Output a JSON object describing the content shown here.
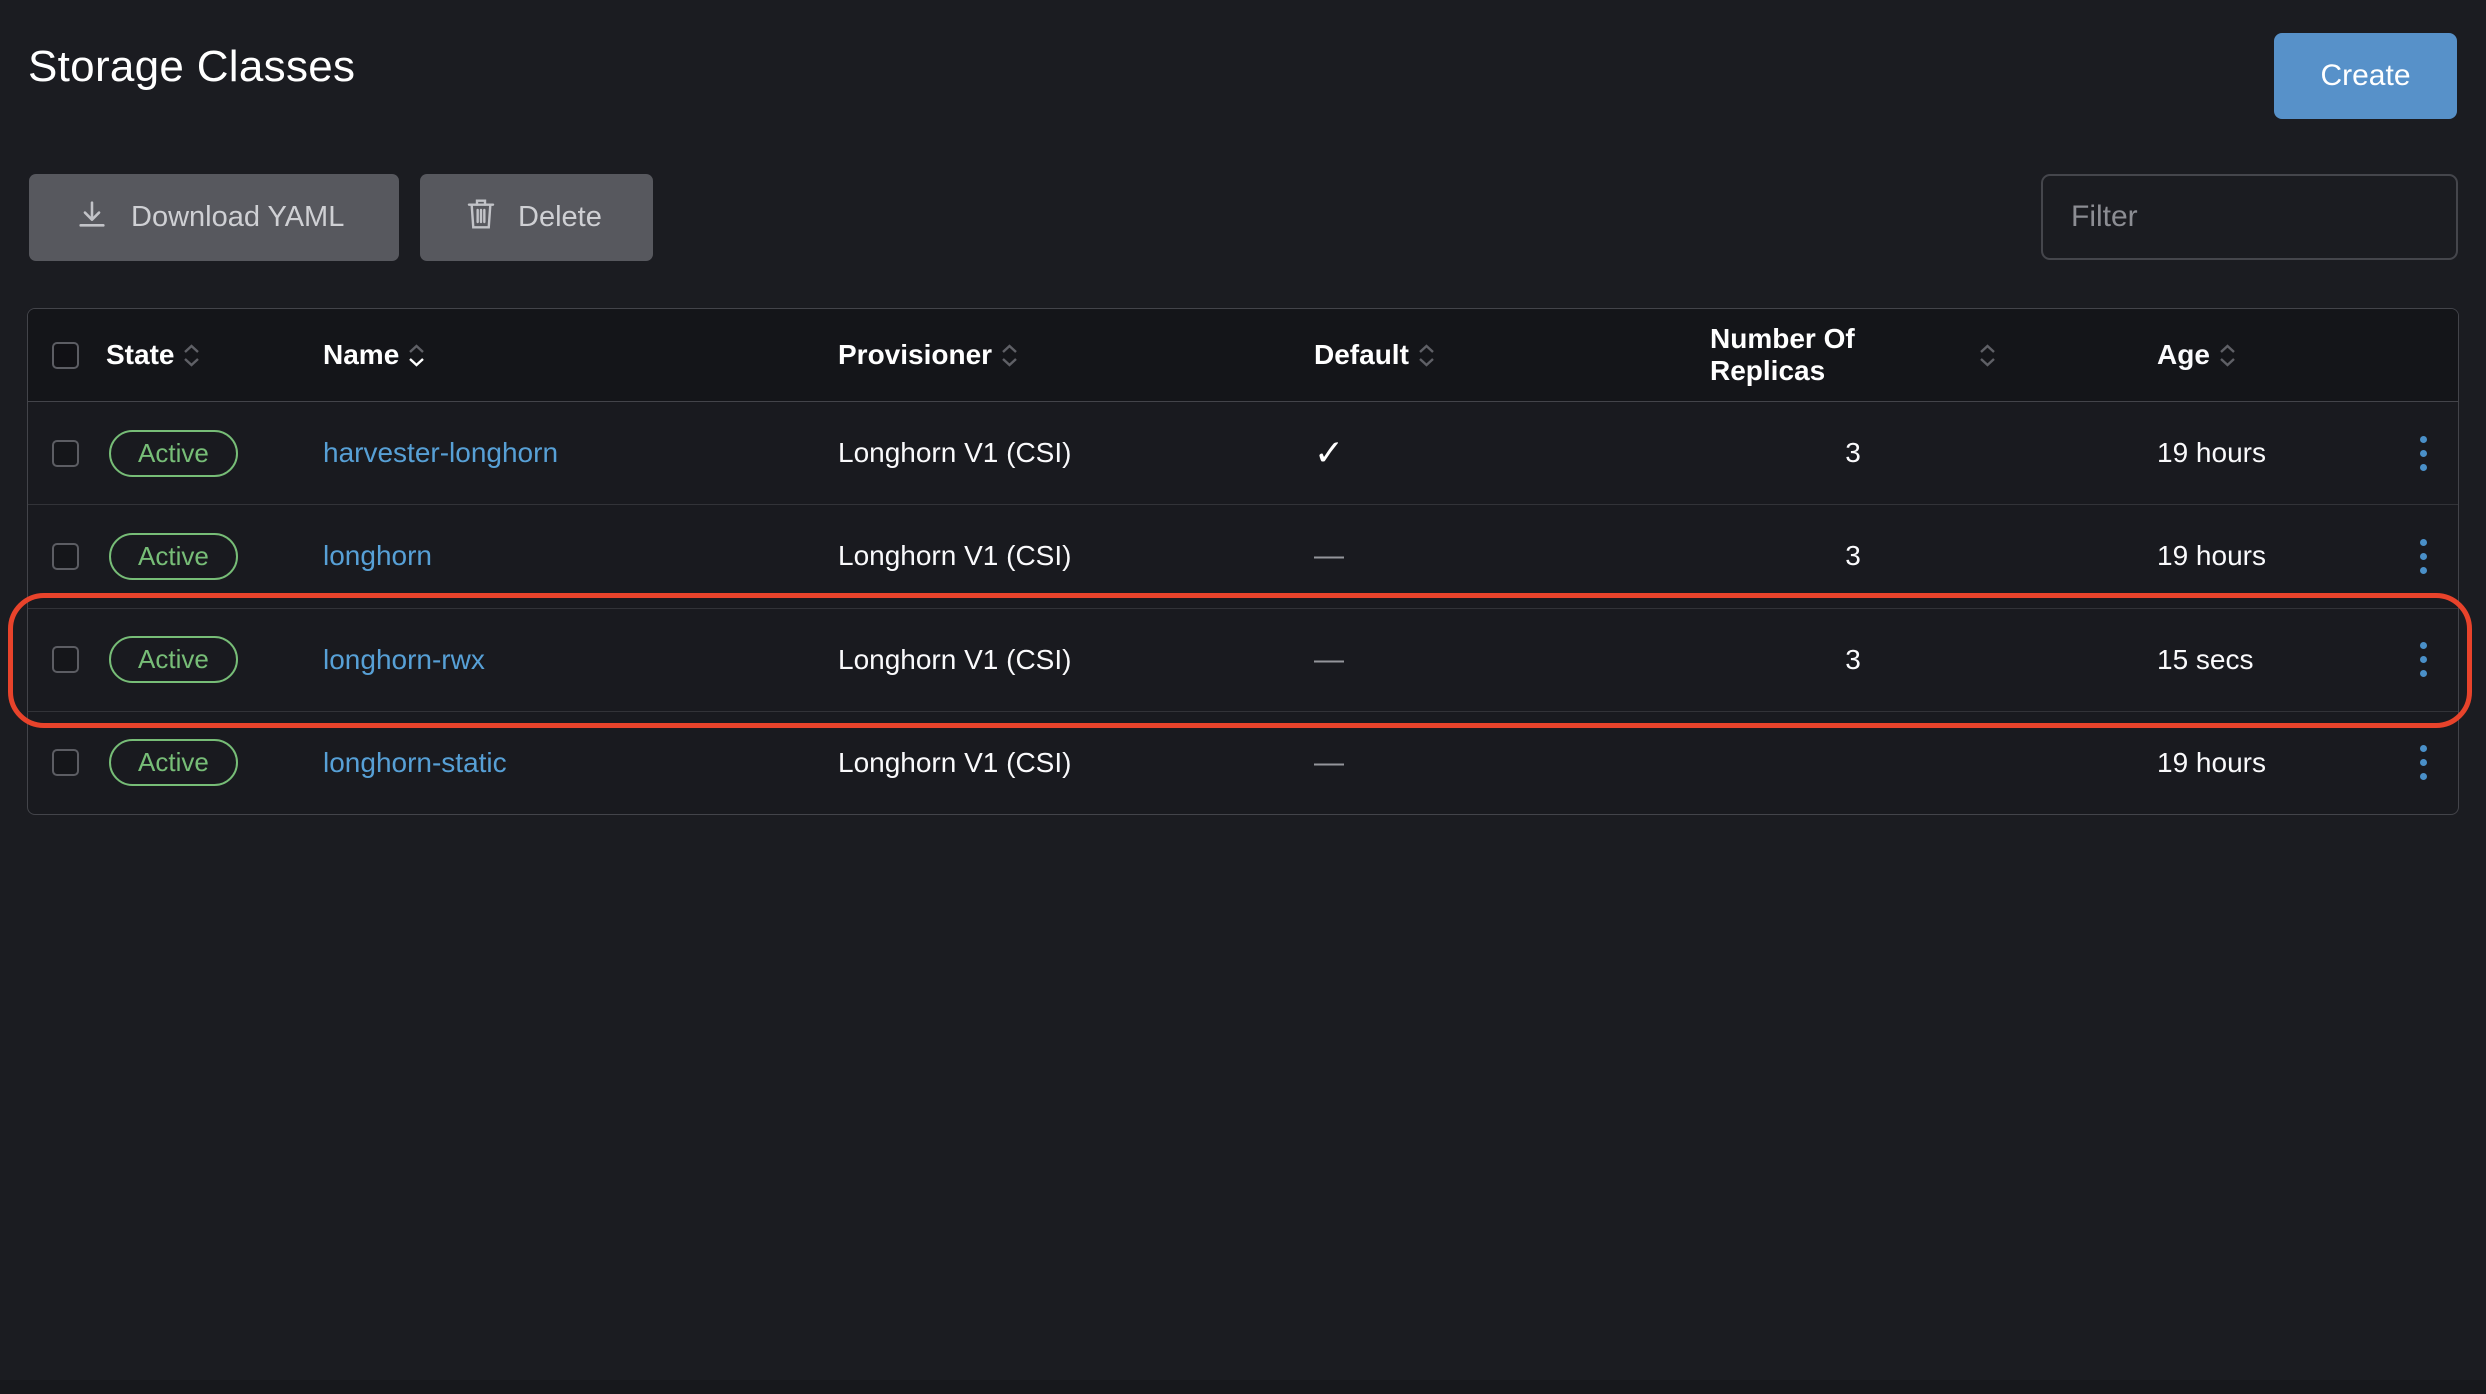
{
  "page": {
    "title": "Storage Classes"
  },
  "header": {
    "create_label": "Create"
  },
  "toolbar": {
    "download_label": "Download YAML",
    "delete_label": "Delete",
    "filter_placeholder": "Filter"
  },
  "table": {
    "columns": [
      "State",
      "Name",
      "Provisioner",
      "Default",
      "Number Of Replicas",
      "Age"
    ],
    "sort": {
      "column": "Name",
      "active_arrow": "down"
    },
    "rows": [
      {
        "state": "Active",
        "name": "harvester-longhorn",
        "provisioner": "Longhorn V1 (CSI)",
        "default": "✓",
        "replicas": "3",
        "age": "19 hours"
      },
      {
        "state": "Active",
        "name": "longhorn",
        "provisioner": "Longhorn V1 (CSI)",
        "default": "—",
        "replicas": "3",
        "age": "19 hours"
      },
      {
        "state": "Active",
        "name": "longhorn-rwx",
        "provisioner": "Longhorn V1 (CSI)",
        "default": "—",
        "replicas": "3",
        "age": "15 secs",
        "highlighted": true
      },
      {
        "state": "Active",
        "name": "longhorn-static",
        "provisioner": "Longhorn V1 (CSI)",
        "default": "—",
        "replicas": "",
        "age": "19 hours"
      }
    ]
  },
  "colors": {
    "background": "#1b1c21",
    "primary_button": "#5791c9",
    "gray_button": "#57585e",
    "link": "#57a0d6",
    "state_active": "#77bd77",
    "kebab_dots": "#4a90c8",
    "annotation": "#e8432b",
    "table_header_bg": "#141519",
    "table_border": "#43444a"
  }
}
